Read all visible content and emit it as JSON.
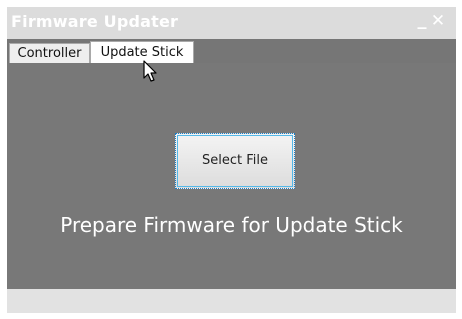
{
  "window": {
    "title": "Firmware Updater",
    "minimize_glyph": "_",
    "close_glyph": "✕"
  },
  "tabs": [
    {
      "label": "Controller",
      "selected": false
    },
    {
      "label": "Update Stick",
      "selected": true
    }
  ],
  "content": {
    "select_file_label": "Select File",
    "message": "Prepare Firmware for Update Stick"
  },
  "colors": {
    "content_background": "#787878",
    "button_focus_border": "#54b8e8"
  },
  "icons": {
    "cursor": "mouse-pointer-icon"
  }
}
